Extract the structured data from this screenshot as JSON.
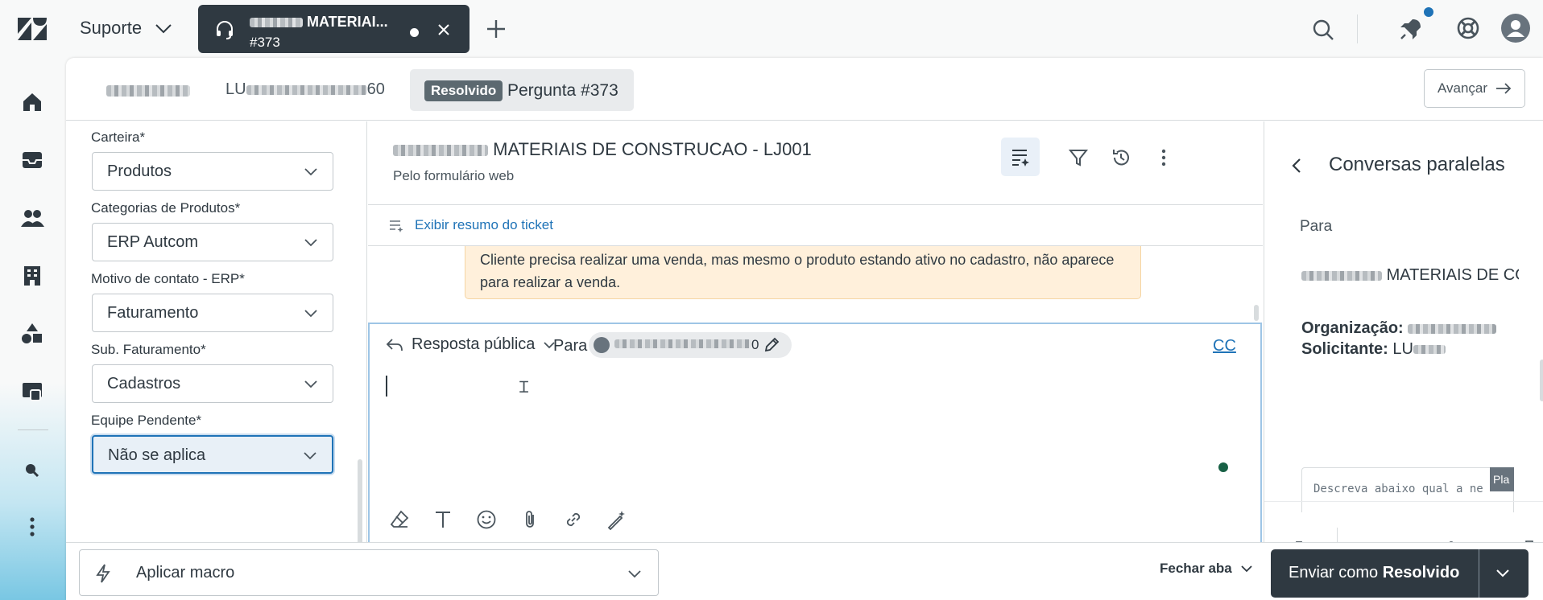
{
  "topbar": {
    "product_label": "Suporte",
    "tab_title": "MATERIAI...",
    "tab_subtitle": "#373"
  },
  "header": {
    "requester_tab": "LU",
    "requester_tab_suffix": "60",
    "ticket_status": "Resolvido",
    "ticket_label": "Pergunta #373",
    "next_button": "Avançar"
  },
  "properties": {
    "fields": [
      {
        "label": "Carteira*",
        "value": "Produtos"
      },
      {
        "label": "Categorias de Produtos*",
        "value": "ERP Autcom"
      },
      {
        "label": "Motivo de contato - ERP*",
        "value": "Faturamento"
      },
      {
        "label": "Sub. Faturamento*",
        "value": "Cadastros"
      },
      {
        "label": "Equipe Pendente*",
        "value": "Não se aplica"
      }
    ]
  },
  "conversation": {
    "title": "MATERIAIS DE CONSTRUCAO - LJ001",
    "subtitle": "Pelo formulário web",
    "summary_link": "Exibir resumo do ticket",
    "note_text": "Cliente precisa realizar uma venda, mas mesmo o produto estando ativo no cadastro, não aparece para realizar a venda."
  },
  "editor": {
    "reply_type": "Resposta pública",
    "to_label": "Para",
    "recipient_suffix": "0",
    "cc_label": "CC"
  },
  "side_panel": {
    "title": "Conversas paralelas",
    "to_label": "Para",
    "recipient_name": "MATERIAIS DE CO",
    "org_label": "Organização:",
    "requester_label": "Solicitante:",
    "requester_value": "LU",
    "body_placeholder": "Descreva abaixo qual a ne",
    "tooltip_text": "Pla"
  },
  "bottom": {
    "macro_label": "Aplicar macro",
    "close_tab_label": "Fechar aba",
    "submit_prefix": "Enviar como",
    "submit_status": "Resolvido"
  },
  "colors": {
    "brand_dark": "#2f3941",
    "link_blue": "#1f73b7",
    "note_bg": "#fff0db",
    "status_pill": "#5c6970"
  }
}
